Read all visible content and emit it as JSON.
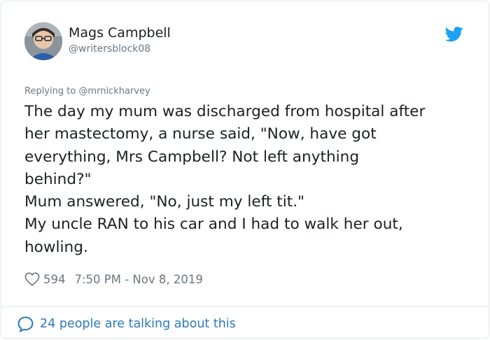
{
  "author": {
    "name": "Mags Campbell",
    "handle": "@writersblock08"
  },
  "reply": {
    "text": "Replying to @mrnickharvey"
  },
  "tweet": {
    "lines": [
      "The day my mum was discharged from hospital after",
      "her mastectomy, a nurse said, \"Now, have got",
      "everything, Mrs Campbell? Not left anything",
      "behind?\"",
      "Mum answered, \"No, just my left tit.\"",
      "My uncle RAN to his car and I had to walk her out,",
      "howling."
    ]
  },
  "meta": {
    "likes": "594",
    "timestamp": "7:50 PM - Nov 8, 2019"
  },
  "footer": {
    "text": "24 people are talking about this"
  },
  "icons": {
    "brand": "twitter-bird-icon",
    "like": "heart-icon",
    "conversation": "speech-bubble-icon"
  },
  "colors": {
    "brand_blue": "#1da1f2",
    "link_blue": "#2b7bb9",
    "muted_text": "#697882",
    "body_text": "#1c2022",
    "border": "#e1e8ed"
  }
}
